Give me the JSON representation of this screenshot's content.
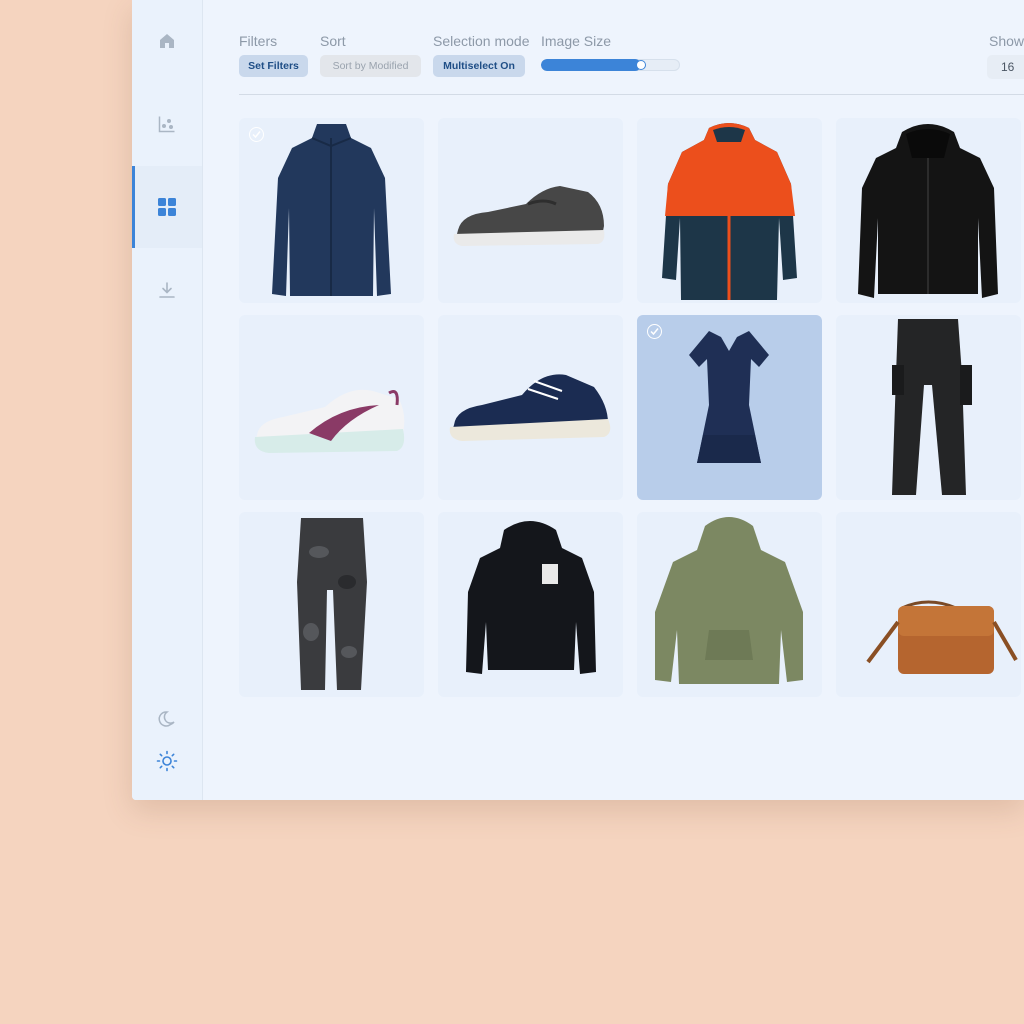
{
  "toolbar": {
    "filters": {
      "label": "Filters",
      "button": "Set Filters"
    },
    "sort": {
      "label": "Sort",
      "button": "Sort by Modified"
    },
    "selection": {
      "label": "Selection mode",
      "button": "Multiselect On"
    },
    "image_size": {
      "label": "Image Size",
      "value_percent": 72
    },
    "show": {
      "label": "Show",
      "value": "16"
    }
  },
  "sidebar": {
    "items": [
      {
        "icon": "home-icon"
      },
      {
        "icon": "analytics-icon"
      },
      {
        "icon": "grid-icon",
        "active": true
      },
      {
        "icon": "download-icon"
      }
    ],
    "bottom": [
      {
        "icon": "moon-icon"
      },
      {
        "icon": "sun-icon",
        "active": true
      }
    ]
  },
  "colors": {
    "accent": "#3c84d8",
    "selected_card": "#b8cdea",
    "card": "#e8f0fb",
    "background": "#f5d4bf"
  },
  "products": [
    {
      "id": "navy-jacket",
      "selected": true
    },
    {
      "id": "grey-slip-on-shoe",
      "selected": false
    },
    {
      "id": "orange-navy-jacket",
      "selected": false
    },
    {
      "id": "black-hoodie-zip",
      "selected": false
    },
    {
      "id": "white-sneaker",
      "selected": false
    },
    {
      "id": "navy-sneaker",
      "selected": false
    },
    {
      "id": "navy-dress",
      "selected": true
    },
    {
      "id": "black-cargo-pants",
      "selected": false
    },
    {
      "id": "camo-pants",
      "selected": false
    },
    {
      "id": "black-hoodie",
      "selected": false
    },
    {
      "id": "olive-hoodie",
      "selected": false
    },
    {
      "id": "brown-bag",
      "selected": false
    }
  ]
}
